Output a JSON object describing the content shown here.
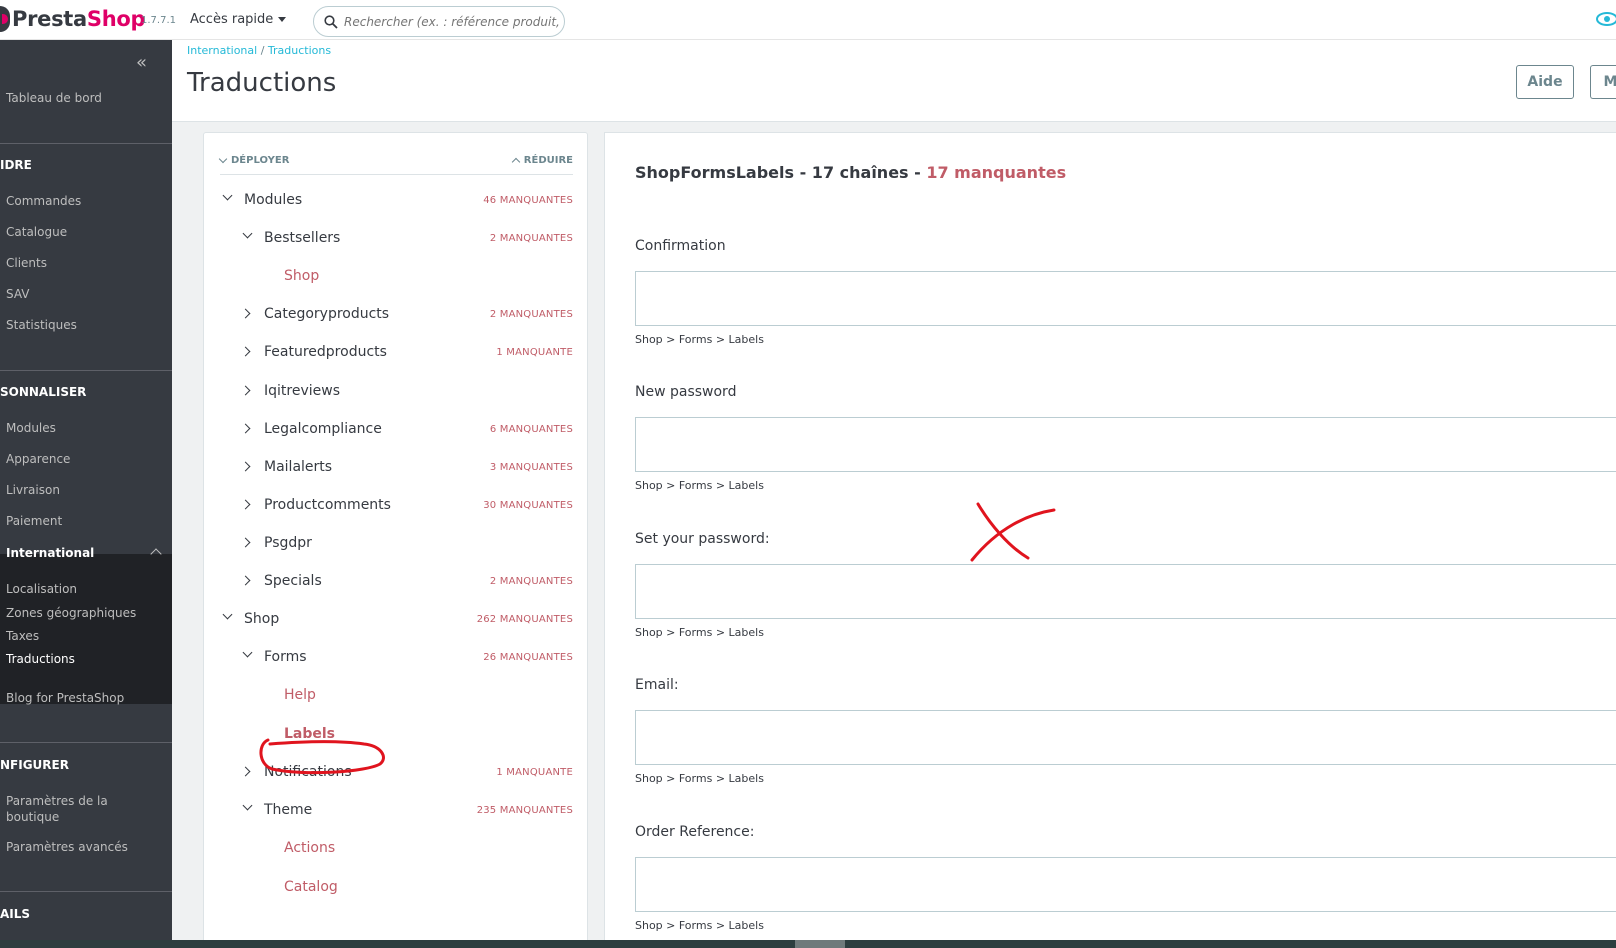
{
  "header": {
    "logo_presta": "Presta",
    "logo_shop": "Shop",
    "version": "1.7.7.1",
    "quick_access": "Accès rapide",
    "search_placeholder": "Rechercher (ex. : référence produit, nom"
  },
  "sidebar": {
    "dashboard": "Tableau de bord",
    "section_sell": "IDRE",
    "sell_items": [
      "Commandes",
      "Catalogue",
      "Clients",
      "SAV",
      "Statistiques"
    ],
    "section_improve": "SONNALISER",
    "improve_items": [
      "Modules",
      "Apparence",
      "Livraison",
      "Paiement"
    ],
    "international": "International",
    "international_sub": [
      "Localisation",
      "Zones géographiques",
      "Taxes",
      "Traductions"
    ],
    "blog": "Blog for PrestaShop",
    "section_configure": "NFIGURER",
    "configure_items": [
      "Paramètres de la",
      "boutique",
      "Paramètres avancés"
    ],
    "section_more": "AILS"
  },
  "page": {
    "breadcrumb_parent": "International",
    "breadcrumb_sep": " / ",
    "breadcrumb_current": "Traductions",
    "title": "Traductions",
    "help_button": "Aide",
    "more_button": "M"
  },
  "tree": {
    "expand": "Déployer",
    "collapse": "Réduire",
    "nodes": [
      {
        "label": "Modules",
        "missing": "46 manquantes"
      },
      {
        "label": "Bestsellers",
        "missing": "2 manquantes"
      },
      {
        "label": "Shop",
        "missing": ""
      },
      {
        "label": "Categoryproducts",
        "missing": "2 manquantes"
      },
      {
        "label": "Featuredproducts",
        "missing": "1 manquante"
      },
      {
        "label": "Iqitreviews",
        "missing": ""
      },
      {
        "label": "Legalcompliance",
        "missing": "6 manquantes"
      },
      {
        "label": "Mailalerts",
        "missing": "3 manquantes"
      },
      {
        "label": "Productcomments",
        "missing": "30 manquantes"
      },
      {
        "label": "Psgdpr",
        "missing": ""
      },
      {
        "label": "Specials",
        "missing": "2 manquantes"
      },
      {
        "label": "Shop",
        "missing": "262 manquantes"
      },
      {
        "label": "Forms",
        "missing": "26 manquantes"
      },
      {
        "label": "Help",
        "missing": ""
      },
      {
        "label": "Labels",
        "missing": ""
      },
      {
        "label": "Notifications",
        "missing": "1 manquante"
      },
      {
        "label": "Theme",
        "missing": "235 manquantes"
      },
      {
        "label": "Actions",
        "missing": ""
      },
      {
        "label": "Catalog",
        "missing": ""
      }
    ]
  },
  "content": {
    "title_prefix": "ShopFormsLabels - 17 chaînes - ",
    "title_missing": "17 manquantes",
    "fields": [
      {
        "label": "Confirmation",
        "value": "",
        "path": "Shop > Forms > Labels"
      },
      {
        "label": "New password",
        "value": "",
        "path": "Shop > Forms > Labels"
      },
      {
        "label": "Set your password:",
        "value": "",
        "path": "Shop > Forms > Labels"
      },
      {
        "label": "Email:",
        "value": "",
        "path": "Shop > Forms > Labels"
      },
      {
        "label": "Order Reference:",
        "value": "",
        "path": "Shop > Forms > Labels"
      }
    ]
  },
  "colors": {
    "brand_pink": "#df0067",
    "link_blue": "#25b9d7",
    "missing_red": "#c05c67",
    "sidebar_bg": "#363a41",
    "annotation_red": "#e0141e"
  }
}
